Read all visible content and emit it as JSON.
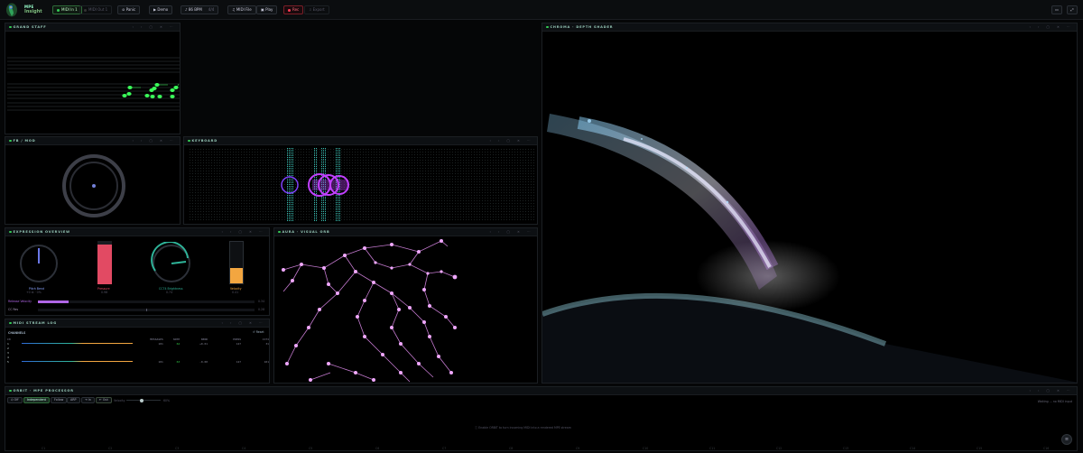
{
  "app": {
    "brand_top": "MPE",
    "brand_bottom": "Insight"
  },
  "toolbar": {
    "midi_in": "MIDI In 1",
    "midi_out": "MIDI Out 1",
    "panic": "Panic",
    "demo": "Demo",
    "tempo": "86 BPM",
    "tempo_sub": "4/4",
    "midi_file": "MIDI File",
    "play": "Play",
    "rec": "Rec",
    "export": "Export"
  },
  "panels": {
    "grand_staff": "GRAND STAFF",
    "fb_mod": "FB / MOD",
    "keyboard": "KEYBOARD",
    "depth": "CHROMA · DEPTH SHADER",
    "expression": "EXPRESSION OVERVIEW",
    "visual_orb": "AURA · VISUAL ORB",
    "log": "MIDI STREAM LOG",
    "processor": "ORBIT · MPE PROCESSOR"
  },
  "expression": {
    "pitch_bend_label": "Pitch Bend",
    "pitch_bend_value": "+0 st · 0%",
    "pressure_label": "Pressure",
    "pressure_value": "0.98",
    "cc74_label": "CC74 Brightness",
    "cc74_value": "0.74",
    "velocity_label": "Velocity",
    "velocity_value": "0.41",
    "release_label": "Release Velocity",
    "release_value": "0.34",
    "cc_label": "CC Res",
    "cc_value": "0.28",
    "pressure_level": 0.92,
    "velocity_level": 0.38,
    "release_level": 0.14
  },
  "log": {
    "section": "CHANNELS",
    "reset": "Reset",
    "headers": [
      "CH",
      "MESSAGES",
      "NOTE",
      "BEND",
      "PRESS",
      "CC74"
    ],
    "rows": [
      [
        "1",
        "101",
        "62",
        "+0.01",
        "127",
        "31"
      ],
      [
        "2",
        "",
        "",
        "",
        "",
        ""
      ],
      [
        "3",
        "",
        "",
        "",
        "",
        ""
      ],
      [
        "4",
        "",
        "",
        "",
        "",
        ""
      ],
      [
        "5",
        "101",
        "63",
        "-0.00",
        "127",
        "101"
      ]
    ]
  },
  "processor": {
    "off": "Off",
    "independent": "Independent",
    "follow": "Follow",
    "arp": "ARP",
    "in": "In",
    "out": "Out",
    "velocity_label": "Velocity",
    "velocity_value": "60%",
    "hint": "Enable ORBIT to turn incoming MIDI into a rendered MPE stream",
    "status": "Waiting ... no MIDI input",
    "ruler": [
      "C1",
      "C2",
      "C3",
      "C4",
      "C5",
      "C6",
      "C7",
      "C8",
      "C9",
      "C10",
      "C11",
      "C12",
      "C13",
      "C14",
      "C15",
      "C16"
    ]
  },
  "colors": {
    "accent_green": "#35d24a",
    "pressure_red": "#e24a63",
    "velocity_orange": "#f3a640",
    "cc74_teal": "#2fb59a",
    "note_purple": "#c040ff",
    "orb_pink": "#e58ef2"
  }
}
